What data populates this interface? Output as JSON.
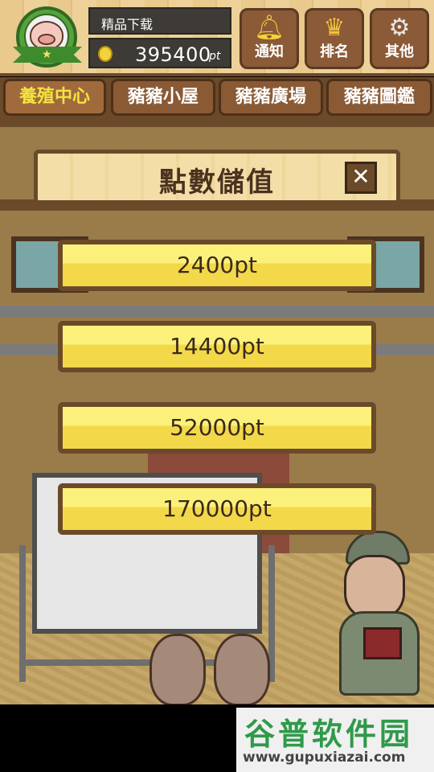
{
  "header": {
    "username": "精品下载",
    "points_value": "395400",
    "points_unit": "pt",
    "buttons": [
      {
        "label": "通知",
        "icon": "bell-icon"
      },
      {
        "label": "排名",
        "icon": "crown-icon"
      },
      {
        "label": "其他",
        "icon": "gear-icon"
      }
    ]
  },
  "tabs": [
    {
      "label": "養殖中心",
      "active": true
    },
    {
      "label": "豬豬小屋",
      "active": false
    },
    {
      "label": "豬豬廣場",
      "active": false
    },
    {
      "label": "豬豬圖鑑",
      "active": false
    }
  ],
  "modal": {
    "title": "點數儲值",
    "close_label": "✕",
    "options": [
      "2400pt",
      "14400pt",
      "52000pt",
      "170000pt"
    ]
  },
  "watermark": {
    "main": "谷普软件园",
    "url": "www.gupuxiazai.com"
  },
  "colors": {
    "wood_dark": "#6b4a2a",
    "option_yellow": "#f3d84a",
    "tab_active_text": "#f2e43e",
    "watermark_green": "#2f9a4a"
  }
}
